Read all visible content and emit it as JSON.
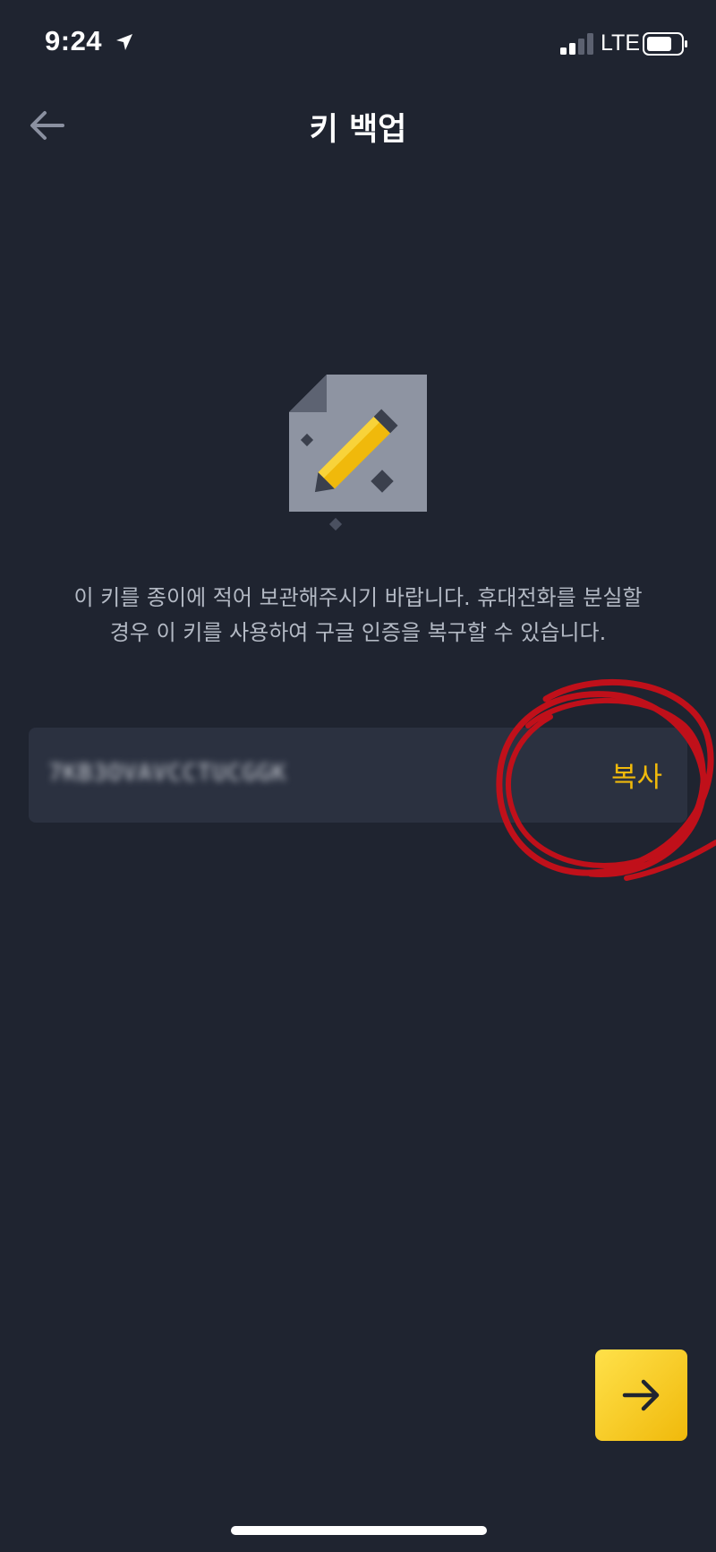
{
  "status_bar": {
    "time": "9:24",
    "network": "LTE",
    "icons": [
      "location-arrow-icon",
      "cellular-signal-icon",
      "battery-icon"
    ]
  },
  "header": {
    "title": "키 백업",
    "back_icon": "back-arrow-icon"
  },
  "illustration": {
    "icon": "document-pencil-icon"
  },
  "description": {
    "line1": "이 키를 종이에 적어 보관해주시기 바랍니다. 휴대전화를 분실할",
    "line2": "경우 이 키를 사용하여 구글 인증을 복구할 수 있습니다."
  },
  "key_box": {
    "key_value": "7KB3OVAVCCTUCGGK",
    "copy_label": "복사"
  },
  "footer": {
    "next_icon": "arrow-right-icon"
  },
  "colors": {
    "background": "#1f2430",
    "surface": "#2b3140",
    "accent": "#f0b90b",
    "annotation": "#c0101a",
    "text_secondary": "#b3b9c4"
  }
}
